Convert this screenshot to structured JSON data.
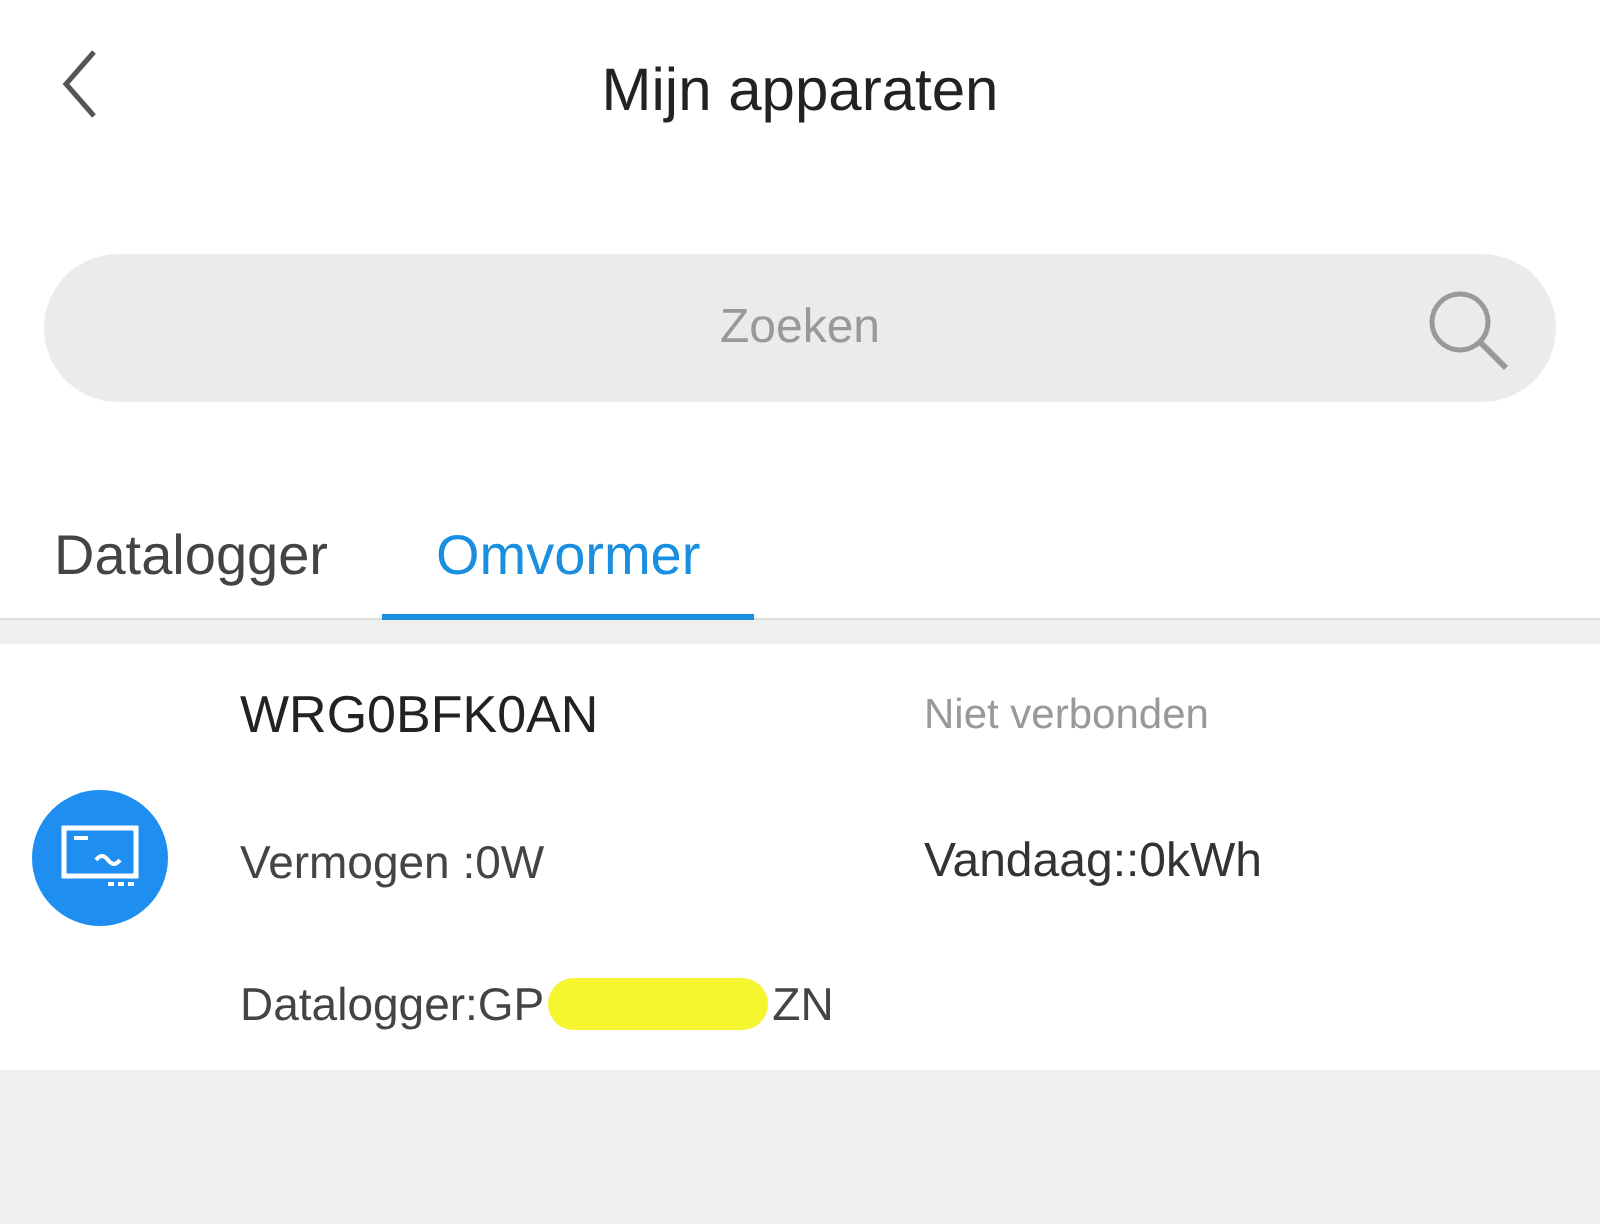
{
  "header": {
    "title": "Mijn apparaten"
  },
  "search": {
    "placeholder": "Zoeken"
  },
  "tabs": [
    {
      "label": "Datalogger",
      "selected": false
    },
    {
      "label": "Omvormer",
      "selected": true
    }
  ],
  "devices": [
    {
      "name": "WRG0BFK0AN",
      "status": "Niet verbonden",
      "power": "Vermogen :0W",
      "today": "Vandaag::0kWh",
      "datalogger_visible_start": "Datalogger:GP",
      "datalogger_visible_end": "ZN"
    }
  ]
}
